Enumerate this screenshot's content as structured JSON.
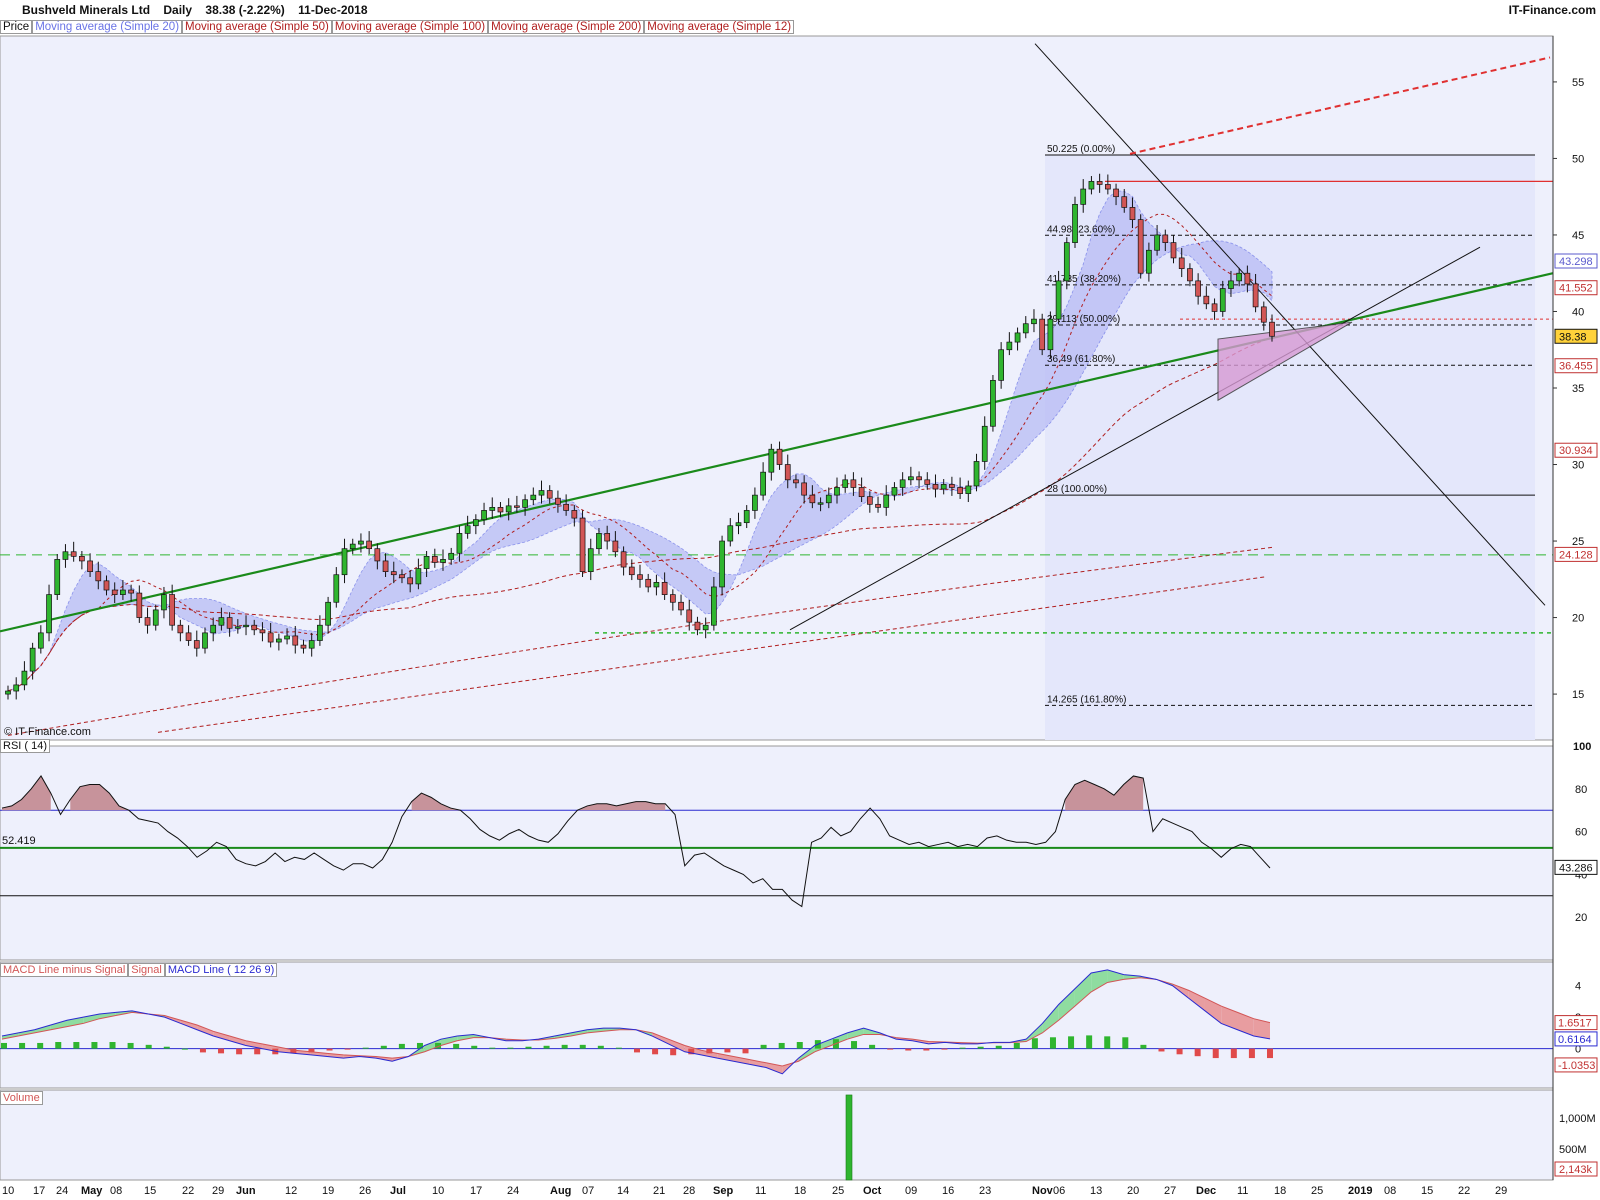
{
  "header": {
    "name": "Bushveld Minerals Ltd",
    "period": "Daily",
    "price_change": "38.38 (-2.22%)",
    "date": "11-Dec-2018",
    "site": "IT-Finance.com"
  },
  "legend": {
    "price": "Price",
    "ma20": "Moving average (Simple 20)",
    "ma50": "Moving average (Simple 50)",
    "ma100": "Moving average (Simple 100)",
    "ma200": "Moving average (Simple 200)",
    "ma12": "Moving average (Simple 12)"
  },
  "copyright": "© IT-Finance.com",
  "colors": {
    "background": "#eef0fc",
    "up_candle": "#2fb52f",
    "down_candle": "#d25656",
    "trend_green": "#1a8a1a",
    "ma_dash": "#b01e1e",
    "band_fill": "#b8bcf5",
    "axis_label_box_blue": "#5a5acd",
    "axis_label_box_red": "#c03030"
  },
  "chart_data": [
    {
      "panel": "price",
      "type": "candlestick",
      "ylim": [
        12,
        58
      ],
      "yticks": [
        15,
        20,
        25,
        30,
        35,
        40,
        45,
        50,
        55
      ],
      "x_labels": [
        "10",
        "17",
        "24",
        "May",
        "08",
        "15",
        "22",
        "29",
        "Jun",
        "12",
        "19",
        "26",
        "Jul",
        "10",
        "17",
        "24",
        "Aug",
        "07",
        "14",
        "21",
        "28",
        "Sep",
        "11",
        "18",
        "25",
        "Oct",
        "09",
        "16",
        "23",
        "Nov",
        "06",
        "13",
        "20",
        "27",
        "Dec",
        "11",
        "18",
        "25",
        "2019",
        "08",
        "15",
        "22",
        "29"
      ],
      "x_label_positions": [
        10,
        41,
        64,
        89,
        118,
        152,
        190,
        220,
        244,
        293,
        330,
        367,
        398,
        440,
        478,
        515,
        558,
        590,
        625,
        661,
        691,
        721,
        763,
        802,
        840,
        871,
        913,
        950,
        987,
        1040,
        1061,
        1098,
        1135,
        1172,
        1204,
        1245,
        1282,
        1319,
        1356,
        1392,
        1429,
        1466,
        1503
      ],
      "close_series": [
        15.2,
        15.6,
        16.5,
        18.0,
        19.0,
        21.5,
        23.8,
        24.3,
        24.0,
        23.7,
        23.0,
        22.4,
        21.8,
        21.5,
        21.8,
        21.6,
        20.0,
        19.5,
        20.5,
        21.5,
        19.5,
        19.0,
        18.5,
        18.0,
        19.0,
        19.5,
        20.0,
        19.3,
        19.4,
        19.5,
        19.2,
        19.0,
        18.4,
        18.6,
        18.8,
        18.2,
        18.0,
        18.5,
        19.5,
        21.0,
        22.8,
        24.5,
        24.8,
        25.0,
        24.5,
        23.7,
        23.0,
        22.8,
        22.6,
        22.2,
        23.2,
        24.0,
        23.6,
        23.8,
        24.2,
        25.5,
        26.0,
        26.4,
        27.0,
        27.2,
        26.9,
        27.3,
        27.2,
        27.7,
        28.0,
        28.3,
        27.8,
        27.4,
        27.0,
        26.5,
        23.0,
        24.5,
        25.5,
        25.0,
        24.3,
        23.3,
        22.8,
        22.5,
        22.0,
        22.3,
        21.5,
        21.0,
        20.5,
        19.7,
        19.2,
        19.5,
        22.0,
        25.0,
        26.0,
        26.2,
        27.0,
        28.0,
        29.5,
        31.0,
        30.0,
        29.0,
        28.8,
        28.0,
        27.5,
        27.5,
        28.0,
        28.5,
        29.0,
        28.5,
        27.9,
        27.4,
        27.2,
        28.0,
        28.5,
        29.0,
        29.2,
        29.0,
        28.7,
        28.4,
        28.7,
        28.5,
        28.1,
        28.6,
        30.2,
        32.5,
        35.5,
        37.5,
        38.0,
        38.6,
        39.2,
        39.5,
        37.5,
        39.5,
        42.0,
        44.5,
        47.0,
        48.0,
        48.5,
        48.3,
        48.0,
        47.5,
        46.8,
        46.0,
        42.5,
        44.0,
        45.0,
        44.5,
        43.5,
        42.8,
        42.0,
        41.0,
        40.5,
        40.0,
        41.5,
        42.0,
        42.5,
        41.8,
        40.3,
        39.3,
        38.38
      ],
      "moving_averages": {
        "ma12_end": 30.9,
        "ma20_end": 43.3,
        "ma50_end": 30.934,
        "ma100_end": 24.128,
        "ma200_end": 24.0
      },
      "fibonacci": [
        {
          "label": "50.225 (0.00%)",
          "value": 50.225
        },
        {
          "label": "44.98 (23.60%)",
          "value": 44.98
        },
        {
          "label": "41.735 (38.20%)",
          "value": 41.735
        },
        {
          "label": "39.113 (50.00%)",
          "value": 39.113
        },
        {
          "label": "36.49 (61.80%)",
          "value": 36.49
        },
        {
          "label": "28 (100.00%)",
          "value": 28.0
        },
        {
          "label": "14.265 (161.80%)",
          "value": 14.265
        }
      ],
      "right_axis_labels": [
        {
          "text": "43.298",
          "value": 43.298,
          "style": "blue"
        },
        {
          "text": "41.552",
          "value": 41.552,
          "style": "red"
        },
        {
          "text": "38.38",
          "value": 38.38,
          "style": "current"
        },
        {
          "text": "36.455",
          "value": 36.455,
          "style": "red"
        },
        {
          "text": "30.934",
          "value": 30.934,
          "style": "red"
        },
        {
          "text": "24.128",
          "value": 24.128,
          "style": "red"
        }
      ],
      "horizontal_levels": {
        "red_resistance": 48.5,
        "green_dashed_upper": 24.1,
        "green_dashed_lower": 19.0,
        "red_dotted": 39.5
      }
    },
    {
      "panel": "rsi",
      "type": "line",
      "title": "RSI ( 14)",
      "ylim": [
        0,
        100
      ],
      "yticks": [
        20,
        40,
        60,
        80,
        100
      ],
      "levels": [
        70,
        30
      ],
      "current_label": "52.419",
      "current_value": 52.419,
      "last_label": "43.286",
      "last_value": 43.286,
      "values": [
        71,
        72,
        75,
        80,
        86,
        78,
        68,
        75,
        81,
        82,
        82,
        78,
        72,
        70,
        66,
        65,
        64,
        60,
        57,
        53,
        48,
        51,
        55,
        53,
        47,
        45,
        44,
        46,
        50,
        46,
        48,
        47,
        50,
        47,
        44,
        42,
        45,
        45,
        43,
        47,
        55,
        67,
        74,
        78,
        76,
        73,
        71,
        70,
        66,
        61,
        58,
        56,
        59,
        61,
        58,
        56,
        55,
        59,
        65,
        70,
        72,
        73,
        73,
        72,
        73,
        74,
        74,
        73,
        73,
        68,
        44,
        49,
        50,
        47,
        44,
        42,
        40,
        36,
        38,
        33,
        33,
        28,
        25,
        55,
        57,
        62,
        58,
        60,
        66,
        71,
        66,
        58,
        56,
        54,
        55,
        53,
        54,
        55,
        53,
        54,
        53,
        57,
        58,
        56,
        55,
        55,
        54,
        55,
        60,
        75,
        82,
        84,
        82,
        80,
        77,
        82,
        86,
        85,
        60,
        66,
        64,
        62,
        60,
        55,
        52,
        48,
        52,
        54,
        53,
        48,
        43
      ]
    },
    {
      "panel": "macd",
      "type": "line",
      "legend": [
        "MACD Line minus Signal",
        "Signal",
        "MACD Line ( 12 26 9)"
      ],
      "ylim": [
        -2.5,
        5.5
      ],
      "yticks": [
        0,
        2,
        4
      ],
      "right_axis_labels": [
        {
          "text": "1.6517",
          "value": 1.6517,
          "style": "red"
        },
        {
          "text": "0.6164",
          "value": 0.6164,
          "style": "blue"
        },
        {
          "text": "-1.0353",
          "value": -1.0353,
          "style": "red"
        }
      ],
      "macd_line": [
        0.8,
        1.0,
        1.2,
        1.5,
        1.8,
        2.0,
        2.2,
        2.3,
        2.4,
        2.2,
        2.0,
        1.6,
        1.2,
        0.8,
        0.5,
        0.2,
        0.0,
        -0.2,
        -0.3,
        -0.4,
        -0.5,
        -0.6,
        -0.5,
        -0.6,
        -0.8,
        -0.5,
        0.2,
        0.6,
        0.8,
        0.9,
        0.7,
        0.5,
        0.5,
        0.6,
        0.8,
        1.0,
        1.2,
        1.3,
        1.3,
        1.2,
        0.8,
        0.3,
        -0.2,
        -0.4,
        -0.6,
        -0.8,
        -1.0,
        -1.2,
        -1.6,
        -0.6,
        0.2,
        0.6,
        1.0,
        1.3,
        1.0,
        0.6,
        0.5,
        0.3,
        0.4,
        0.3,
        0.3,
        0.4,
        0.4,
        0.6,
        1.6,
        2.8,
        3.8,
        4.8,
        5.0,
        4.7,
        4.6,
        4.4,
        4.0,
        3.2,
        2.4,
        1.6,
        1.2,
        0.8,
        0.62
      ],
      "signal_line": [
        0.6,
        0.8,
        1.0,
        1.2,
        1.4,
        1.6,
        1.9,
        2.1,
        2.3,
        2.2,
        2.1,
        1.8,
        1.5,
        1.1,
        0.8,
        0.5,
        0.3,
        0.1,
        -0.1,
        -0.2,
        -0.3,
        -0.4,
        -0.45,
        -0.5,
        -0.6,
        -0.5,
        -0.2,
        0.2,
        0.5,
        0.7,
        0.7,
        0.6,
        0.55,
        0.55,
        0.65,
        0.8,
        1.0,
        1.1,
        1.2,
        1.2,
        1.0,
        0.6,
        0.2,
        -0.1,
        -0.3,
        -0.5,
        -0.7,
        -0.9,
        -1.1,
        -0.8,
        -0.2,
        0.2,
        0.6,
        0.9,
        0.9,
        0.7,
        0.6,
        0.45,
        0.42,
        0.38,
        0.35,
        0.37,
        0.38,
        0.45,
        1.0,
        1.8,
        2.7,
        3.6,
        4.2,
        4.4,
        4.5,
        4.4,
        4.1,
        3.7,
        3.2,
        2.7,
        2.3,
        1.9,
        1.65
      ],
      "histogram": [
        0.6,
        0.6,
        0.6,
        0.7,
        0.7,
        0.7,
        0.7,
        0.6,
        0.4,
        0.2,
        0.0,
        -0.4,
        -0.5,
        -0.6,
        -0.6,
        -0.6,
        -0.5,
        -0.4,
        -0.2,
        -0.1,
        0.1,
        0.3,
        0.5,
        0.6,
        0.6,
        0.5,
        0.3,
        0.1,
        0.1,
        0.2,
        0.3,
        0.4,
        0.4,
        0.3,
        0.1,
        -0.4,
        -0.6,
        -0.7,
        -0.6,
        -0.5,
        -0.4,
        -0.5,
        0.4,
        0.6,
        0.7,
        0.9,
        1.0,
        0.8,
        0.4,
        -0.1,
        -0.2,
        -0.2,
        -0.1,
        0.1,
        0.2,
        0.3,
        0.6,
        1.1,
        1.2,
        1.3,
        1.4,
        1.3,
        1.2,
        0.4,
        -0.3,
        -0.6,
        -0.8,
        -1.0,
        -1.0,
        -1.0,
        -1.0
      ]
    },
    {
      "panel": "volume",
      "type": "bar",
      "title": "Volume",
      "ylim": [
        0,
        1450
      ],
      "yticks_labels": [
        "500M",
        "1,000M"
      ],
      "yticks_values": [
        500,
        1000
      ],
      "spike_value": 1370,
      "last_label": "2,143k"
    }
  ]
}
